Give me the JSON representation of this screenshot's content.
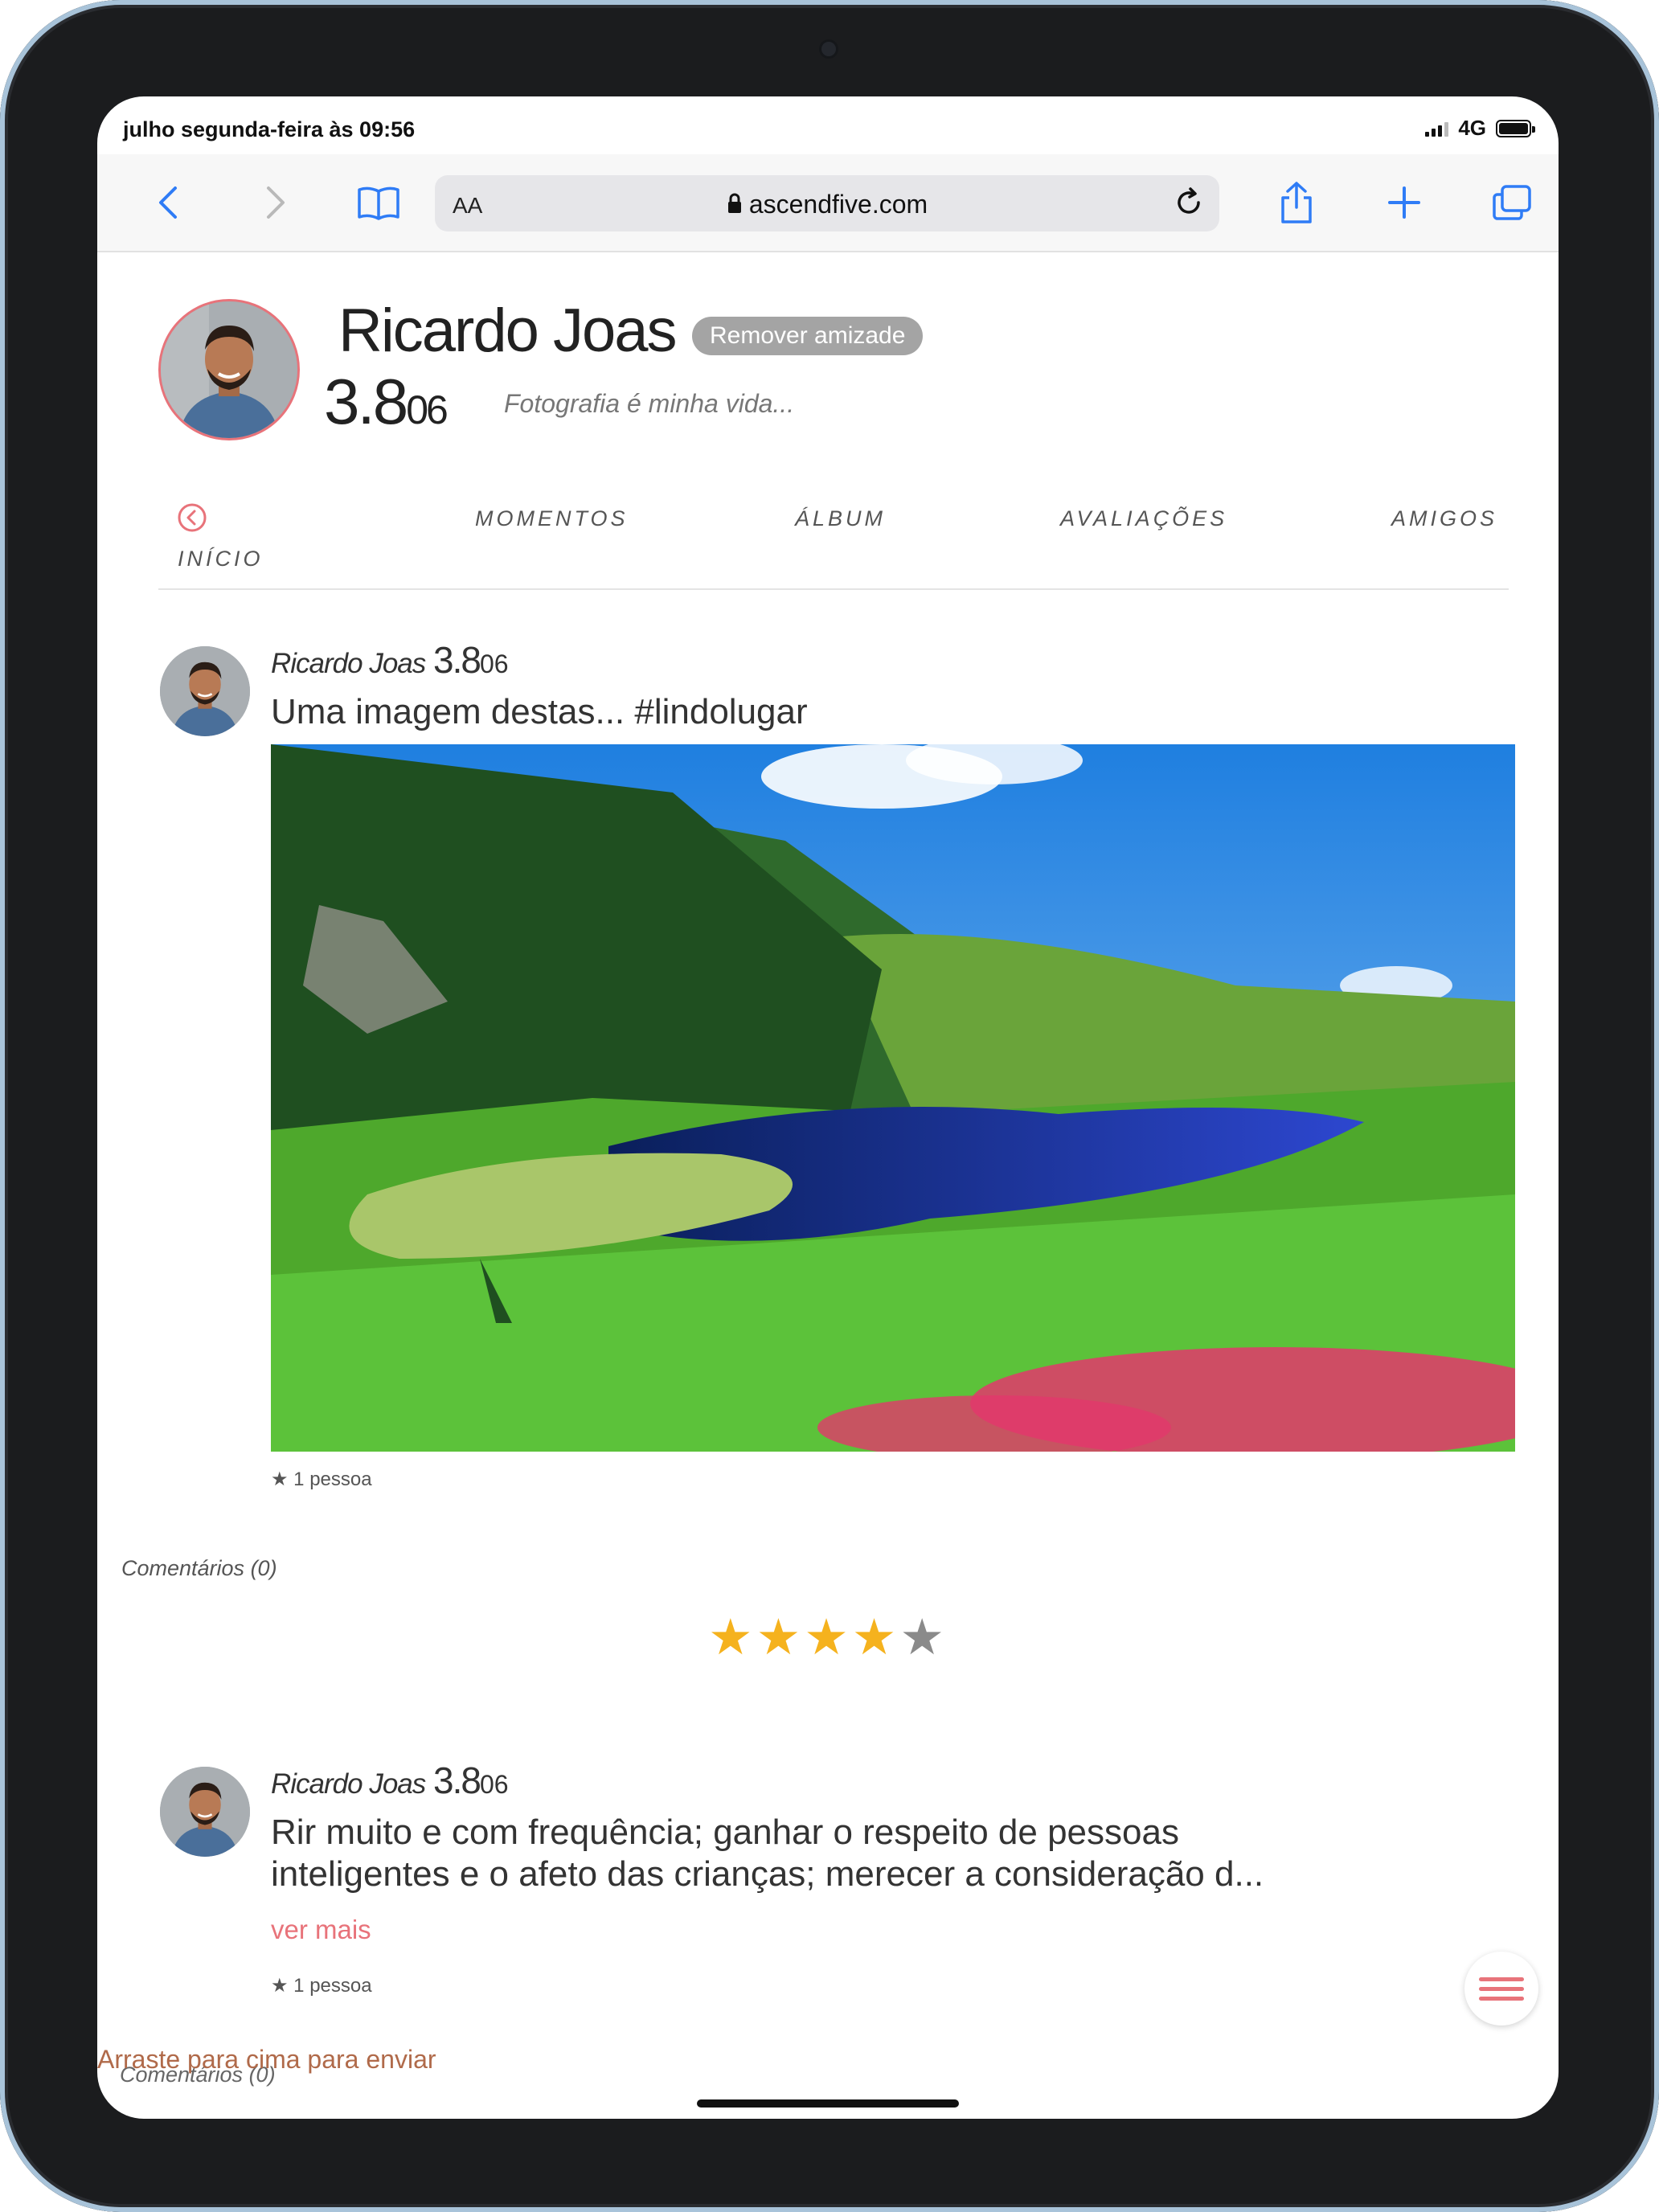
{
  "status_bar": {
    "time": "julho segunda-feira às 09:56",
    "network": "4G"
  },
  "browser": {
    "text_size_label": "AA",
    "domain": "ascendfive.com",
    "icons": [
      "back-icon",
      "forward-icon",
      "bookmarks-icon",
      "lock-icon",
      "reload-icon",
      "share-icon",
      "new-tab-icon",
      "tabs-icon"
    ]
  },
  "profile": {
    "name": "Ricardo Joas",
    "remove_friend_label": "Remover amizade",
    "score_main": "3.8",
    "score_small": "06",
    "tagline": "Fotografia é minha vida..."
  },
  "tabs": {
    "home": "INÍCIO",
    "moments": "MOMENTOS",
    "album": "ÁLBUM",
    "reviews": "AVALIAÇÕES",
    "friends": "AMIGOS"
  },
  "posts": [
    {
      "author": "Ricardo Joas",
      "score_main": "3.8",
      "score_small": "06",
      "text": "Uma imagem destas... #lindolugar",
      "likes": "★ 1 pessoa",
      "comments": "Comentários (0)"
    },
    {
      "author": "Ricardo Joas",
      "score_main": "3.8",
      "score_small": "06",
      "text_line1": "Rir muito e com frequência; ganhar o respeito de pessoas",
      "text_line2": "inteligentes e o afeto das crianças; merecer a consideração d...",
      "more": "ver mais",
      "likes": "★ 1 pessoa",
      "comments": "Comentários (0)"
    }
  ],
  "rating": {
    "stars": 4,
    "max": 5
  },
  "swipe_hint": "Arraste para cima para enviar",
  "colors": {
    "accent": "#e8737a",
    "star": "#f5b21e",
    "frame": "#1b1c1e"
  }
}
